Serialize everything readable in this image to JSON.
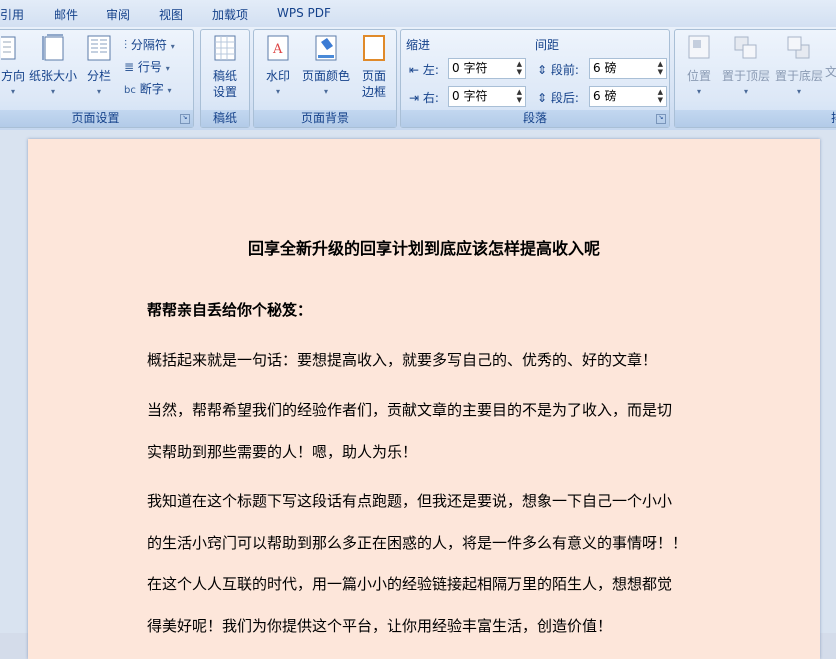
{
  "tabs": [
    "引用",
    "邮件",
    "审阅",
    "视图",
    "加载项",
    "WPS PDF"
  ],
  "groups": {
    "page_setup": {
      "label": "页面设置",
      "direction": "方向",
      "paper_size": "纸张大小",
      "columns": "分栏",
      "breaks": "分隔符",
      "line_numbers": "行号",
      "hyphenation": "断字"
    },
    "manuscript": {
      "label": "稿纸",
      "settings_line1": "稿纸",
      "settings_line2": "设置"
    },
    "page_background": {
      "label": "页面背景",
      "watermark": "水印",
      "page_color": "页面颜色",
      "border_line1": "页面",
      "border_line2": "边框"
    },
    "paragraph": {
      "label": "段落",
      "indent_title": "缩进",
      "spacing_title": "间距",
      "left_label": "左:",
      "left_value": "0 字符",
      "right_label": "右:",
      "right_value": "0 字符",
      "before_label": "段前:",
      "before_value": "6 磅",
      "after_label": "段后:",
      "after_value": "6 磅"
    },
    "arrange": {
      "position": "位置",
      "bring_front": "置于顶层",
      "send_back": "置于底层",
      "text_wrap": "文",
      "label_partial": "排"
    }
  },
  "document": {
    "title": "回享全新升级的回享计划到底应该怎样提高收入呢",
    "heading": "帮帮亲自丢给你个秘笈：",
    "lines": [
      "概括起来就是一句话：要想提高收入，就要多写自己的、优秀的、好的文章！",
      "当然，帮帮希望我们的经验作者们，贡献文章的主要目的不是为了收入，而是切",
      "实帮助到那些需要的人！嗯，助人为乐！",
      "我知道在这个标题下写这段话有点跑题，但我还是要说，想象一下自己一个小小",
      "的生活小窍门可以帮助到那么多正在困惑的人，将是一件多么有意义的事情呀！！",
      "在这个人人互联的时代，用一篇小小的经验链接起相隔万里的陌生人，想想都觉",
      "得美好呢！我们为你提供这个平台，让你用经验丰富生活，创造价值！"
    ]
  },
  "colors": {
    "page_bg": "#fde6da",
    "ribbon_text": "#15428b"
  }
}
